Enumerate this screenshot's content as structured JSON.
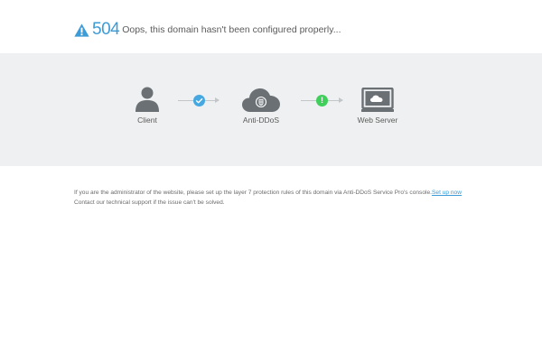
{
  "header": {
    "icon": "warning-triangle-icon",
    "code": "504",
    "message": "Oops, this domain hasn't been configured properly..."
  },
  "flow": {
    "nodes": [
      {
        "label": "Client",
        "icon": "user-icon"
      },
      {
        "label": "Anti-DDoS",
        "icon": "cloud-shield-icon"
      },
      {
        "label": "Web Server",
        "icon": "monitor-cloud-icon"
      }
    ],
    "links": [
      {
        "status": "ok",
        "icon": "check-circle-icon",
        "color": "#46a8e0"
      },
      {
        "status": "warning",
        "icon": "exclamation-circle-icon",
        "color": "#3fcf5b",
        "symbol": "!"
      }
    ]
  },
  "info": {
    "line1_text": "If you are the administrator of the website, please set up the layer 7 protection rules of this domain via Anti-DDoS Service Pro's console.",
    "line1_link": "Set up now",
    "line2_text": "Contact our technical support if the issue can't be solved."
  },
  "colors": {
    "accent": "#3d9bd5",
    "band_bg": "#eff0f1",
    "icon_gray": "#6b7075"
  }
}
